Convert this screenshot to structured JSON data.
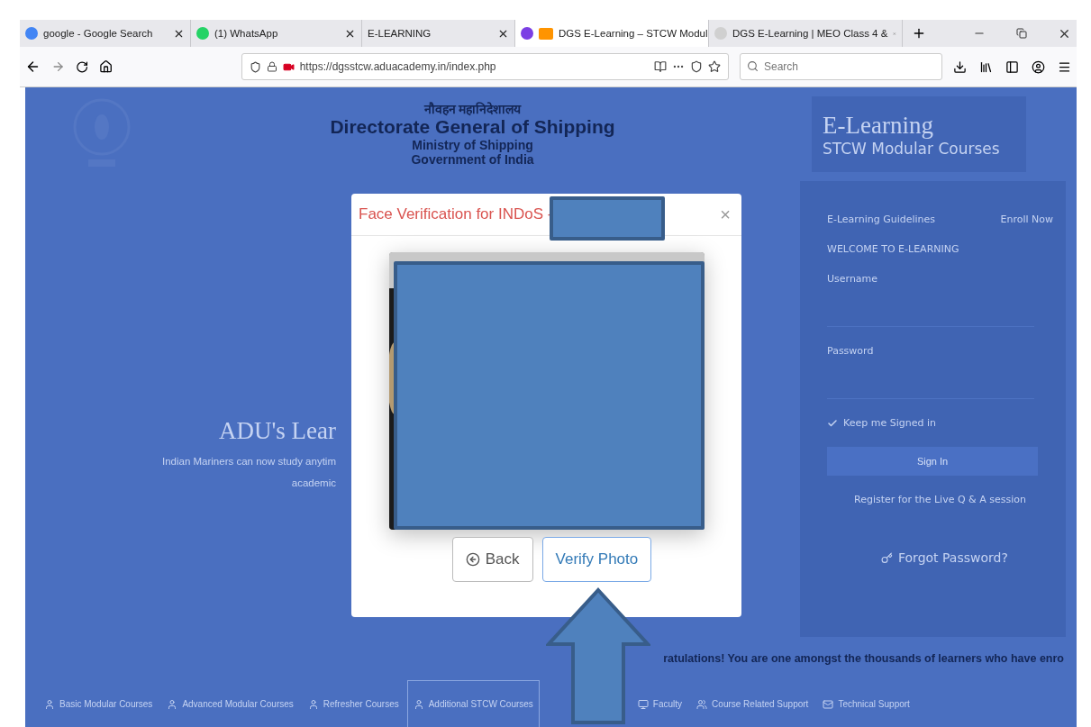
{
  "browser": {
    "tabs": [
      {
        "label": "google - Google Search",
        "selected": false
      },
      {
        "label": "(1) WhatsApp",
        "selected": false
      },
      {
        "label": "E-LEARNING",
        "selected": false
      },
      {
        "label": "DGS E-Learning – STCW Modul",
        "selected": true
      },
      {
        "label": "DGS E-Learning | MEO Class 4 &",
        "selected": false
      }
    ],
    "address": "https://dgsstcw.aduacademy.in/index.php",
    "search": {
      "placeholder": "Search"
    }
  },
  "page": {
    "header": {
      "hindi": "नौवहन महानिदेशालय",
      "title": "Directorate General of Shipping",
      "ministry": "Ministry of Shipping",
      "government": "Government of India"
    },
    "logo": {
      "title": "E-Learning",
      "subtitle": "STCW Modular Courses"
    },
    "hero": {
      "title": "ADU's Lear",
      "lines": [
        "Indian Mariners can now study anytim",
        "academic"
      ]
    },
    "login": {
      "links": [
        "E-Learning Guidelines",
        "Enroll Now"
      ],
      "welcome": "WELCOME TO E-LEARNING",
      "username_label": "Username",
      "password_label": "Password",
      "remember": {
        "label": "Keep me Signed in",
        "checked": true
      },
      "sign_in": "Sign In",
      "register": "Register for the Live Q & A session",
      "forgot": "Forgot Password?"
    },
    "marquee": "ratulations! You are one amongst the thousands of learners who have enro",
    "nav": [
      {
        "label": "Basic Modular Courses",
        "selected": false
      },
      {
        "label": "Advanced Modular Courses",
        "selected": false
      },
      {
        "label": "Refresher Courses",
        "selected": false
      },
      {
        "label": "Additional STCW Courses",
        "selected": true
      },
      {
        "label": "Faculty",
        "selected": false
      },
      {
        "label": "Course Related Support",
        "selected": false
      },
      {
        "label": "Technical Support",
        "selected": false
      }
    ]
  },
  "modal": {
    "title": "Face Verification for INDoS -",
    "close": "×",
    "buttons": [
      {
        "label": "Back",
        "kind": "back"
      },
      {
        "label": "Verify Photo",
        "kind": "primary"
      }
    ]
  }
}
